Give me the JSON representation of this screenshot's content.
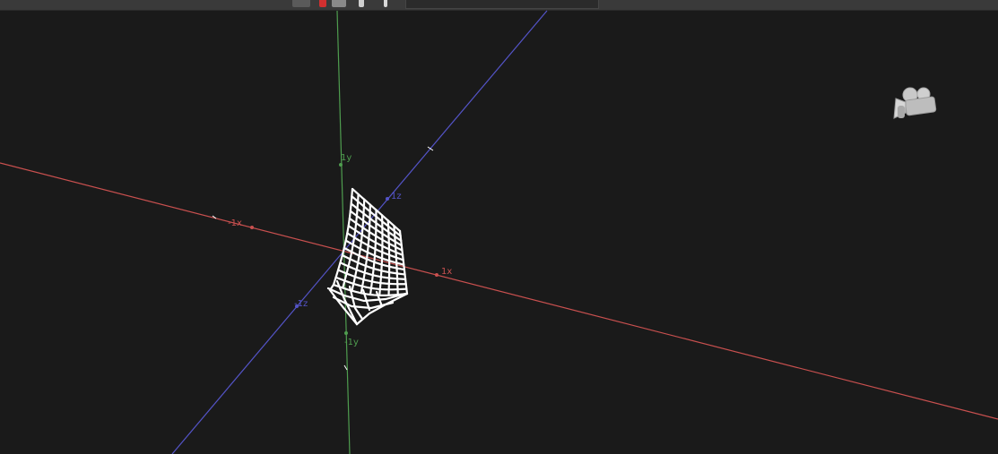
{
  "axes": {
    "x": {
      "positive_label": "1x",
      "negative_label": "-1x",
      "color": "#c9504f"
    },
    "y": {
      "positive_label": "1y",
      "negative_label": "-1y",
      "color": "#4f9d4f"
    },
    "z": {
      "positive_label": "1z",
      "negative_label": "-1z",
      "color": "#5454c8"
    }
  },
  "mesh": {
    "color": "#ffffff",
    "style": "wireframe"
  },
  "icons": {
    "camera": "camera-icon",
    "toolbar_view": "view-toggle-icon",
    "toolbar_record": "record-icon",
    "toolbar_select": "pointer-icon"
  },
  "colors": {
    "background": "#1a1a1a",
    "toolbar": "#3a3a3a",
    "record": "#d23030"
  }
}
